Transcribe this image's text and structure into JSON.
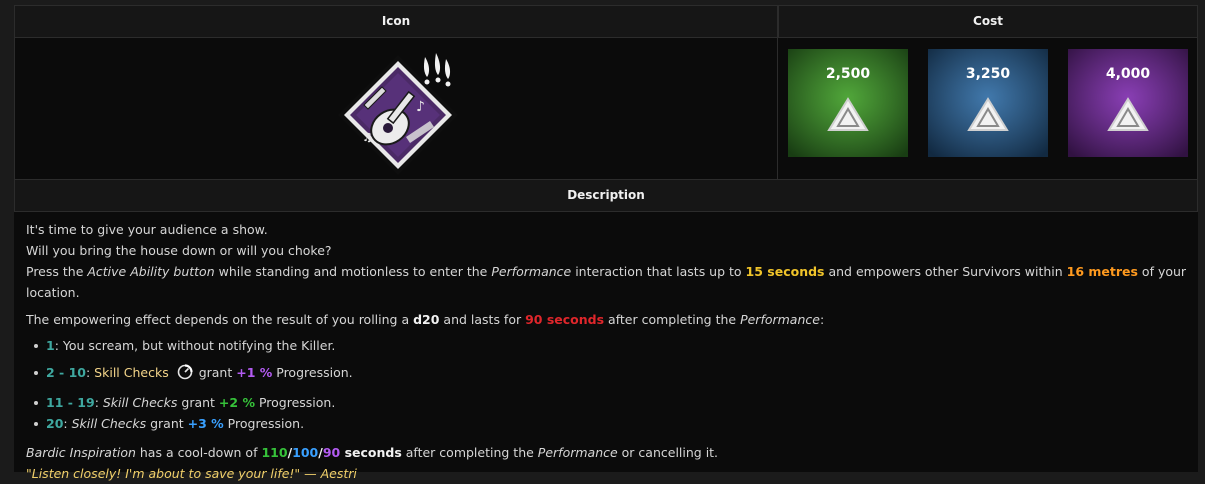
{
  "headers": {
    "icon": "Icon",
    "cost": "Cost",
    "description": "Description"
  },
  "perk": {
    "icon": "bardic-inspiration-perk-icon",
    "color": "#4b2a66"
  },
  "costs": [
    {
      "amount": "2,500",
      "color": "#3f8a2e",
      "icon": "iridescent-shard-icon"
    },
    {
      "amount": "3,250",
      "color": "#2c5f8e",
      "icon": "iridescent-shard-icon"
    },
    {
      "amount": "4,000",
      "color": "#6e2a92",
      "icon": "iridescent-shard-icon"
    }
  ],
  "description": {
    "line1": "It's time to give your audience a show.",
    "line2": "Will you bring the house down or will you choke?",
    "line3": {
      "a": "Press the ",
      "b": "Active Ability button",
      "c": " while standing and motionless to enter the ",
      "d": "Performance",
      "e": " interaction that lasts up to ",
      "f": "15 seconds",
      "g": " and empowers other Survivors within ",
      "h": "16 metres",
      "i": " of your location."
    },
    "line4": {
      "a": "The empowering effect depends on the result of you rolling a ",
      "b": "d20",
      "c": " and lasts for ",
      "d": "90 seconds",
      "e": " after completing the ",
      "f": "Performance",
      "g": ":"
    },
    "bullets": [
      {
        "range": "1",
        "text": ": You scream, but without notifying the Killer."
      },
      {
        "range": "2 - 10",
        "colon": ": ",
        "skill": "Skill Checks",
        "grant": "grant ",
        "bonus": "+1 %",
        "progress": " Progression."
      },
      {
        "range": "11 - 19",
        "colon": ": ",
        "skill": "Skill Checks",
        "grant": " grant ",
        "bonus": "+2 %",
        "progress": " Progression."
      },
      {
        "range": "20",
        "colon": ": ",
        "skill": "Skill Checks",
        "grant": " grant ",
        "bonus": "+3 %",
        "progress": " Progression."
      }
    ],
    "cooldown": {
      "name": "Bardic Inspiration",
      "a": " has a cool-down of ",
      "v1": "110",
      "s1": "/",
      "v2": "100",
      "s2": "/",
      "v3": "90",
      "unit": " seconds",
      "b": " after completing the ",
      "c": "Performance",
      "d": " or cancelling it."
    },
    "quote": "\"Listen closely! I'm about to save your life!\" — Aestri"
  }
}
